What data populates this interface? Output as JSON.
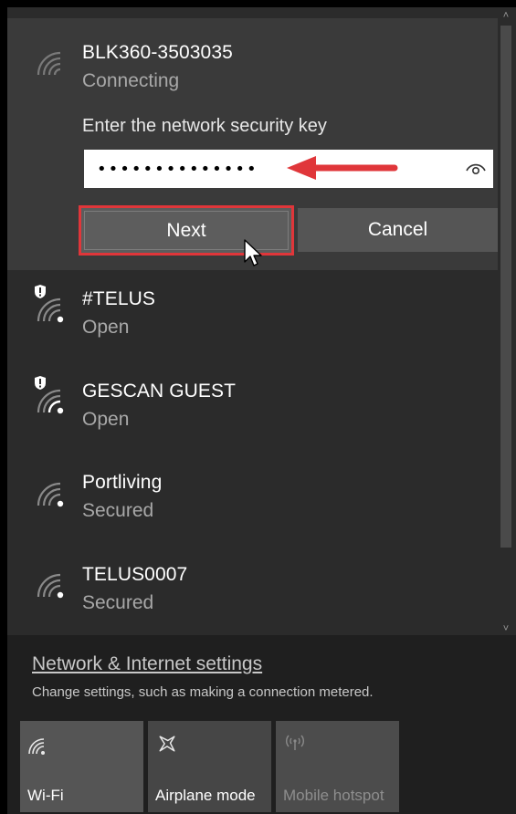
{
  "connecting_network": {
    "name": "BLK360-3503035",
    "status": "Connecting",
    "prompt": "Enter the network security key",
    "key_value": "••••••••••••••",
    "next_label": "Next",
    "cancel_label": "Cancel"
  },
  "networks": [
    {
      "name": "#TELUS",
      "status": "Open",
      "shield": true
    },
    {
      "name": "GESCAN GUEST",
      "status": "Open",
      "shield": true
    },
    {
      "name": "Portliving",
      "status": "Secured",
      "shield": false
    },
    {
      "name": "TELUS0007",
      "status": "Secured",
      "shield": false
    }
  ],
  "settings": {
    "link": "Network & Internet settings",
    "description": "Change settings, such as making a connection metered."
  },
  "quick_actions": [
    {
      "label": "Wi-Fi",
      "icon": "wifi-icon",
      "state": "on"
    },
    {
      "label": "Airplane mode",
      "icon": "airplane-icon",
      "state": "off"
    },
    {
      "label": "Mobile hotspot",
      "icon": "hotspot-icon",
      "state": "disabled"
    }
  ],
  "colors": {
    "panel_bg": "#2b2b2b",
    "selected_bg": "#3a3a3a",
    "highlight": "#e0363a"
  }
}
